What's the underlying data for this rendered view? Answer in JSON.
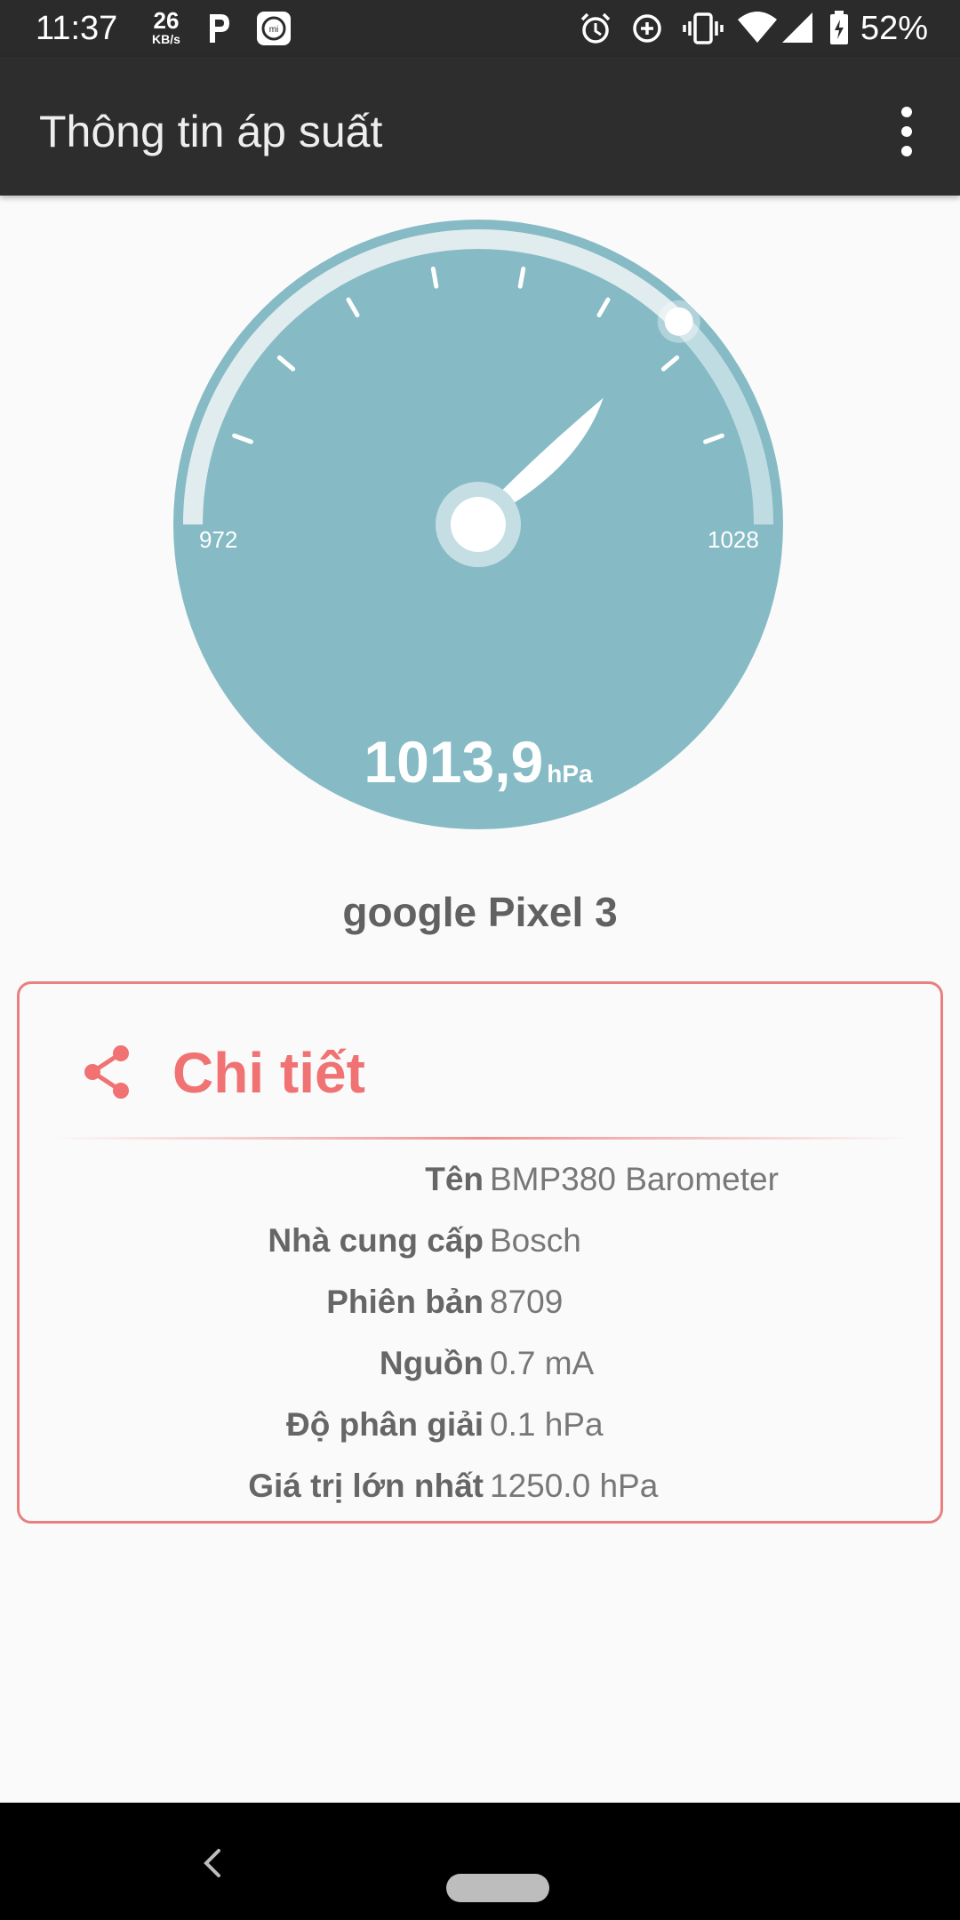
{
  "status_bar": {
    "time": "11:37",
    "net_speed_value": "26",
    "net_speed_unit": "KB/s",
    "battery_percent": "52%",
    "icons": [
      "parking-icon",
      "mi-app-icon",
      "alarm-icon",
      "data-saver-icon",
      "vibrate-icon",
      "wifi-icon",
      "signal-icon",
      "battery-icon"
    ]
  },
  "app_bar": {
    "title": "Thông tin áp suất",
    "menu_icon": "more-vert-icon"
  },
  "gauge": {
    "value": "1013,9",
    "unit": "hPa",
    "min_label": "972",
    "max_label": "1028",
    "min": 972,
    "max": 1028,
    "reading": 1013.9,
    "color": "#86bbc6"
  },
  "device": {
    "name": "google Pixel 3"
  },
  "details": {
    "title": "Chi tiết",
    "share_icon": "share-icon",
    "accent_color": "#f07272",
    "rows": [
      {
        "label": "Tên",
        "value": "BMP380 Barometer"
      },
      {
        "label": "Nhà cung cấp",
        "value": "Bosch"
      },
      {
        "label": "Phiên bản",
        "value": "8709"
      },
      {
        "label": "Nguồn",
        "value": "0.7 mA"
      },
      {
        "label": "Độ phân giải",
        "value": "0.1 hPa"
      },
      {
        "label": "Giá trị lớn nhất",
        "value": "1250.0 hPa"
      }
    ]
  },
  "nav_bar": {
    "icons": [
      "back-icon",
      "home-pill-icon"
    ]
  }
}
